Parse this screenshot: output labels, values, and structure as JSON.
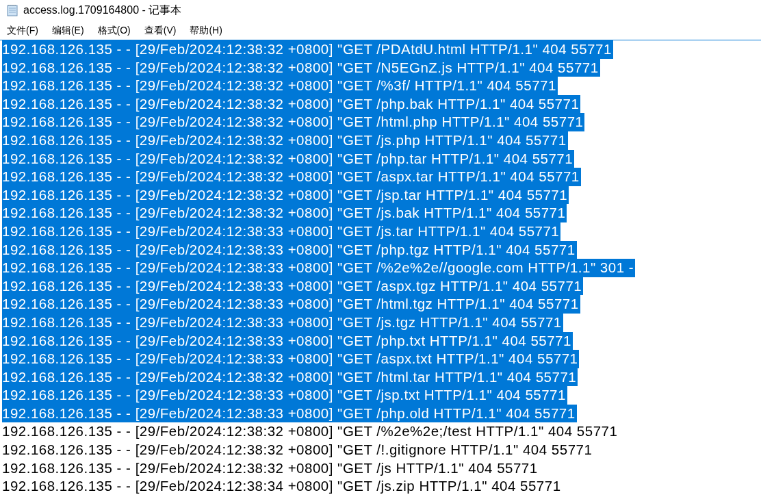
{
  "window": {
    "title": "access.log.1709164800 - 记事本"
  },
  "menu": [
    "文件(F)",
    "编辑(E)",
    "格式(O)",
    "查看(V)",
    "帮助(H)"
  ],
  "lines": [
    {
      "text": "192.168.126.135 - - [29/Feb/2024:12:38:32 +0800] \"GET /PDAtdU.html HTTP/1.1\" 404 55771",
      "selected": true
    },
    {
      "text": "192.168.126.135 - - [29/Feb/2024:12:38:32 +0800] \"GET /N5EGnZ.js HTTP/1.1\" 404 55771",
      "selected": true
    },
    {
      "text": "192.168.126.135 - - [29/Feb/2024:12:38:32 +0800] \"GET /%3f/ HTTP/1.1\" 404 55771",
      "selected": true
    },
    {
      "text": "192.168.126.135 - - [29/Feb/2024:12:38:32 +0800] \"GET /php.bak HTTP/1.1\" 404 55771",
      "selected": true
    },
    {
      "text": "192.168.126.135 - - [29/Feb/2024:12:38:32 +0800] \"GET /html.php HTTP/1.1\" 404 55771",
      "selected": true
    },
    {
      "text": "192.168.126.135 - - [29/Feb/2024:12:38:32 +0800] \"GET /js.php HTTP/1.1\" 404 55771",
      "selected": true
    },
    {
      "text": "192.168.126.135 - - [29/Feb/2024:12:38:32 +0800] \"GET /php.tar HTTP/1.1\" 404 55771",
      "selected": true
    },
    {
      "text": "192.168.126.135 - - [29/Feb/2024:12:38:32 +0800] \"GET /aspx.tar HTTP/1.1\" 404 55771",
      "selected": true
    },
    {
      "text": "192.168.126.135 - - [29/Feb/2024:12:38:32 +0800] \"GET /jsp.tar HTTP/1.1\" 404 55771",
      "selected": true
    },
    {
      "text": "192.168.126.135 - - [29/Feb/2024:12:38:32 +0800] \"GET /js.bak HTTP/1.1\" 404 55771",
      "selected": true
    },
    {
      "text": "192.168.126.135 - - [29/Feb/2024:12:38:33 +0800] \"GET /js.tar HTTP/1.1\" 404 55771",
      "selected": true
    },
    {
      "text": "192.168.126.135 - - [29/Feb/2024:12:38:33 +0800] \"GET /php.tgz HTTP/1.1\" 404 55771",
      "selected": true
    },
    {
      "text": "192.168.126.135 - - [29/Feb/2024:12:38:33 +0800] \"GET /%2e%2e//google.com HTTP/1.1\" 301 -",
      "selected": true
    },
    {
      "text": "192.168.126.135 - - [29/Feb/2024:12:38:33 +0800] \"GET /aspx.tgz HTTP/1.1\" 404 55771",
      "selected": true
    },
    {
      "text": "192.168.126.135 - - [29/Feb/2024:12:38:33 +0800] \"GET /html.tgz HTTP/1.1\" 404 55771",
      "selected": true
    },
    {
      "text": "192.168.126.135 - - [29/Feb/2024:12:38:33 +0800] \"GET /js.tgz HTTP/1.1\" 404 55771",
      "selected": true
    },
    {
      "text": "192.168.126.135 - - [29/Feb/2024:12:38:33 +0800] \"GET /php.txt HTTP/1.1\" 404 55771",
      "selected": true
    },
    {
      "text": "192.168.126.135 - - [29/Feb/2024:12:38:33 +0800] \"GET /aspx.txt HTTP/1.1\" 404 55771",
      "selected": true
    },
    {
      "text": "192.168.126.135 - - [29/Feb/2024:12:38:32 +0800] \"GET /html.tar HTTP/1.1\" 404 55771",
      "selected": true
    },
    {
      "text": "192.168.126.135 - - [29/Feb/2024:12:38:33 +0800] \"GET /jsp.txt HTTP/1.1\" 404 55771",
      "selected": true
    },
    {
      "text": "192.168.126.135 - - [29/Feb/2024:12:38:33 +0800] \"GET /php.old HTTP/1.1\" 404 55771",
      "selected": true
    },
    {
      "text": "192.168.126.135 - - [29/Feb/2024:12:38:32 +0800] \"GET /%2e%2e;/test HTTP/1.1\" 404 55771",
      "selected": false
    },
    {
      "text": "192.168.126.135 - - [29/Feb/2024:12:38:32 +0800] \"GET /!.gitignore HTTP/1.1\" 404 55771",
      "selected": false
    },
    {
      "text": "192.168.126.135 - - [29/Feb/2024:12:38:32 +0800] \"GET /js HTTP/1.1\" 404 55771",
      "selected": false
    },
    {
      "text": "192.168.126.135 - - [29/Feb/2024:12:38:34 +0800] \"GET /js.zip HTTP/1.1\" 404 55771",
      "selected": false
    }
  ]
}
